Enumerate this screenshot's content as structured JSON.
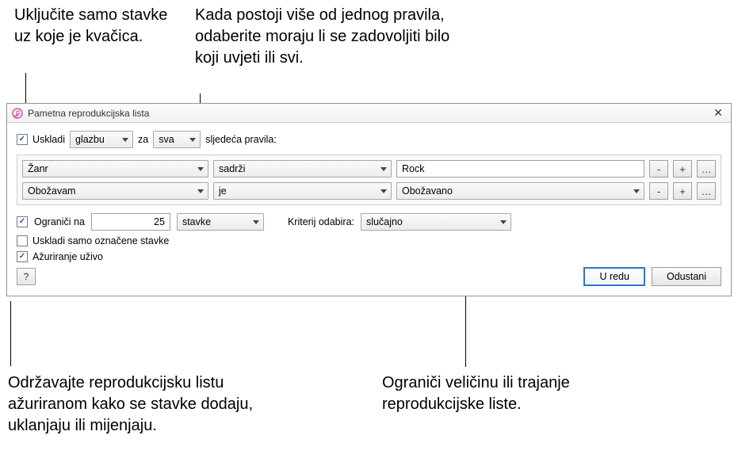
{
  "callouts": {
    "top_left": "Uključite samo stavke uz koje je kvačica.",
    "top_right": "Kada postoji više od jednog pravila, odaberite moraju li se zadovoljiti bilo koji uvjeti ili svi.",
    "bottom_left": "Održavajte reprodukcijsku listu ažuriranom kako se stavke dodaju, uklanjaju ili mijenjaju.",
    "bottom_right": "Ograniči veličinu ili trajanje reprodukcijske liste."
  },
  "dialog": {
    "title": "Pametna reprodukcijska lista",
    "close_glyph": "✕",
    "match": {
      "check_label": "Uskladi",
      "media": "glazbu",
      "for_word": "za",
      "all_any": "sva",
      "suffix": "sljedeća pravila:"
    },
    "rules": [
      {
        "field": "Žanr",
        "op": "sadrži",
        "value_type": "text",
        "value": "Rock"
      },
      {
        "field": "Obožavam",
        "op": "je",
        "value_type": "select",
        "value": "Obožavano"
      }
    ],
    "rule_buttons": {
      "minus": "-",
      "plus": "+",
      "more": "…"
    },
    "limit": {
      "check_label": "Ograniči na",
      "amount": "25",
      "unit": "stavke",
      "criteria_label": "Kriterij odabira:",
      "criteria_value": "slučajno"
    },
    "checked_only_label": "Uskladi samo označene stavke",
    "live_update_label": "Ažuriranje uživo",
    "help_glyph": "?",
    "ok_label": "U redu",
    "cancel_label": "Odustani"
  }
}
